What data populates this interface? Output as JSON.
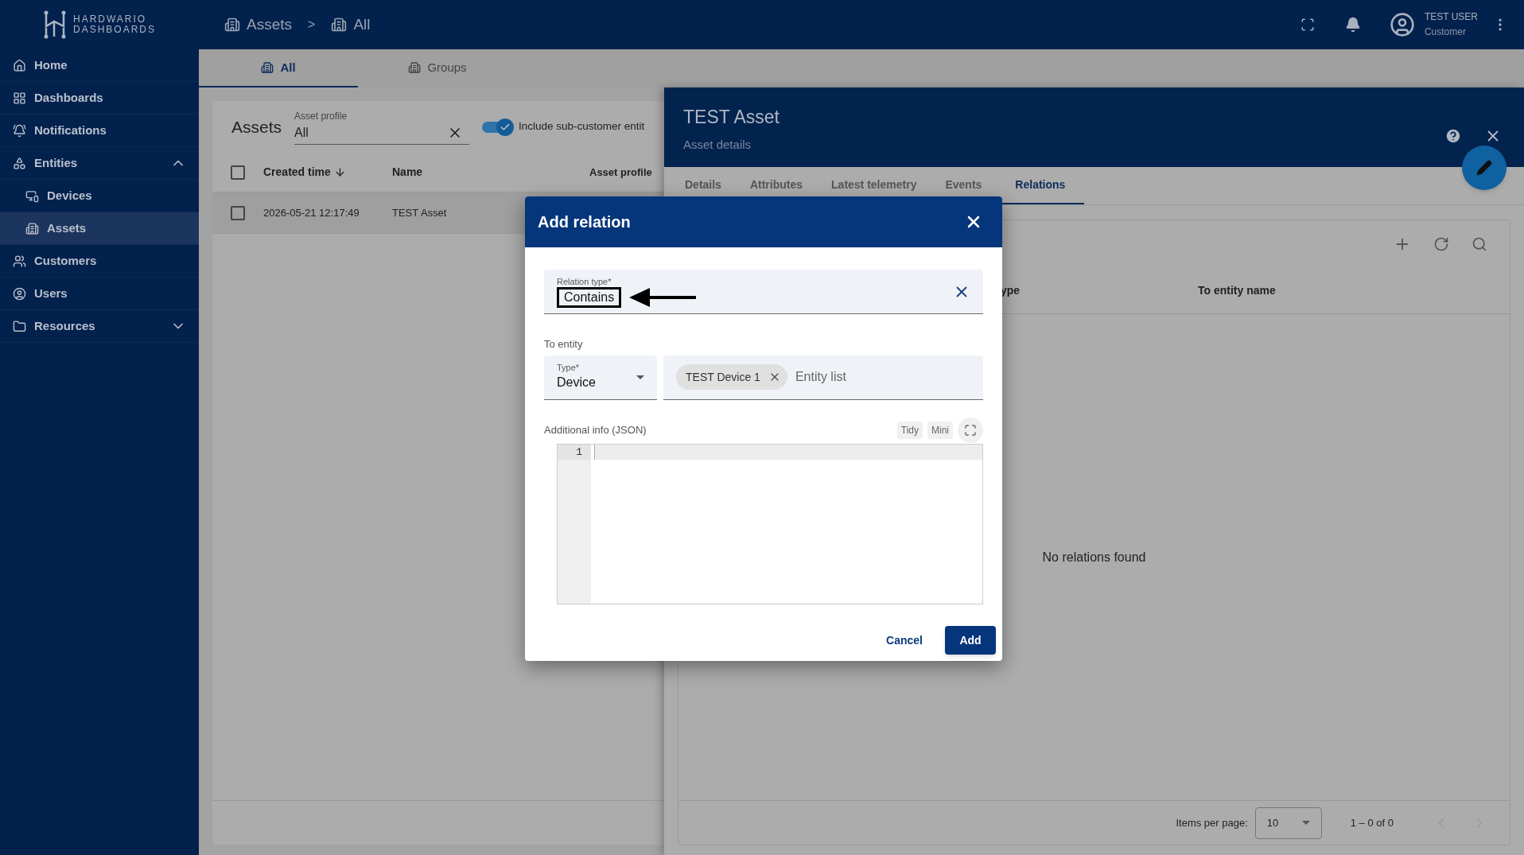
{
  "header": {
    "logo_line1": "HARDWARIO",
    "logo_line2": "DASHBOARDS",
    "breadcrumbs": [
      {
        "label": "Assets"
      },
      {
        "label": "All"
      }
    ],
    "separator": ">",
    "user": {
      "name": "TEST USER",
      "role": "Customer"
    }
  },
  "sidebar": {
    "items": [
      {
        "label": "Home",
        "selected": false
      },
      {
        "label": "Dashboards",
        "selected": false
      },
      {
        "label": "Notifications",
        "selected": false
      },
      {
        "label": "Entities",
        "selected": false,
        "expanded": true,
        "children": [
          {
            "label": "Devices",
            "selected": false
          },
          {
            "label": "Assets",
            "selected": true
          }
        ]
      },
      {
        "label": "Customers",
        "selected": false
      },
      {
        "label": "Users",
        "selected": false
      },
      {
        "label": "Resources",
        "selected": false,
        "expanded": false
      }
    ]
  },
  "asset_tabs": [
    {
      "label": "All",
      "selected": true
    },
    {
      "label": "Groups",
      "selected": false
    }
  ],
  "assets_card": {
    "title": "Assets",
    "filter": {
      "label": "Asset profile",
      "value": "All"
    },
    "toggle": {
      "label": "Include sub-customer entit",
      "on": true
    },
    "header_checked": false,
    "columns": [
      "Created time",
      "Name",
      "Asset profile"
    ],
    "rows": [
      {
        "checked": false,
        "cells": [
          "2026-05-21 12:17:49",
          "TEST Asset"
        ]
      }
    ]
  },
  "details": {
    "title": "TEST Asset",
    "subtitle": "Asset details",
    "tabs": [
      {
        "label": "Details",
        "selected": false
      },
      {
        "label": "Attributes",
        "selected": false
      },
      {
        "label": "Latest telemetry",
        "selected": false
      },
      {
        "label": "Events",
        "selected": false
      },
      {
        "label": "Relations",
        "selected": true
      }
    ],
    "columns": [
      "ype",
      "To entity name"
    ],
    "empty": "No relations found",
    "paginator": {
      "label": "Items per page:",
      "value": "10",
      "range": "1 – 0 of 0"
    }
  },
  "dialog": {
    "title": "Add relation",
    "relation_type": {
      "label": "Relation type*",
      "value": "Contains"
    },
    "to_entity": "To entity",
    "type": {
      "label": "Type*",
      "value": "Device"
    },
    "chips": [
      {
        "label": "TEST Device 1"
      }
    ],
    "entity_placeholder": "Entity list",
    "info_label": "Additional info (JSON)",
    "editor_buttons": [
      "Tidy",
      "Mini"
    ],
    "line_numbers": [
      "1"
    ],
    "cancel": "Cancel",
    "add": "Add"
  }
}
